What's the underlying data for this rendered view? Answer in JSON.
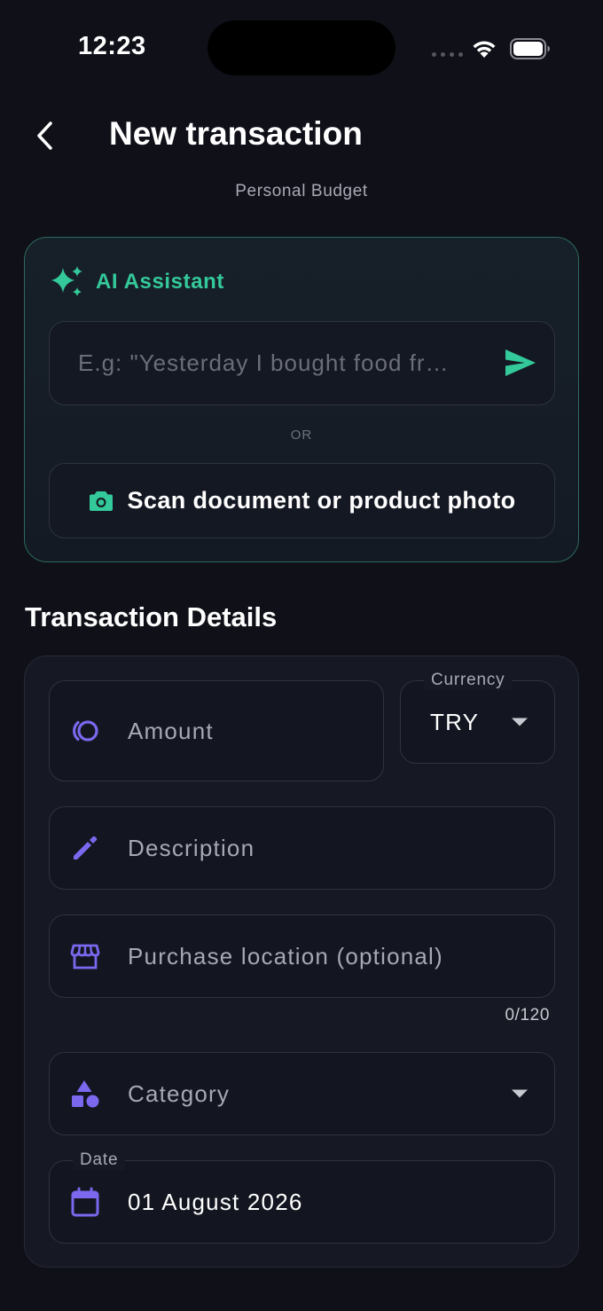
{
  "status_bar": {
    "time": "12:23"
  },
  "header": {
    "title": "New transaction",
    "subtitle": "Personal Budget"
  },
  "ai_assistant": {
    "title": "AI Assistant",
    "input_placeholder": "E.g: \"Yesterday I bought food fr…",
    "input_value": "",
    "or_label": "OR",
    "scan_label": "Scan document or product photo"
  },
  "details": {
    "section_title": "Transaction Details",
    "amount_placeholder": "Amount",
    "currency": {
      "label": "Currency",
      "value": "TRY"
    },
    "description_placeholder": "Description",
    "location_placeholder": "Purchase location (optional)",
    "location_counter": "0/120",
    "category_placeholder": "Category",
    "date": {
      "label": "Date",
      "value": "01 August 2026"
    }
  },
  "colors": {
    "background": "#0f1018",
    "accent_green": "#34c99a",
    "accent_purple": "#7b68ee",
    "card_border_ai": "#2b6a5b"
  },
  "icons": {
    "back": "chevron-left-icon",
    "sparkle": "sparkle-icon",
    "send": "send-icon",
    "camera": "camera-icon",
    "amount": "coins-icon",
    "description": "pencil-icon",
    "location": "store-icon",
    "category": "shapes-icon",
    "date": "calendar-icon"
  }
}
